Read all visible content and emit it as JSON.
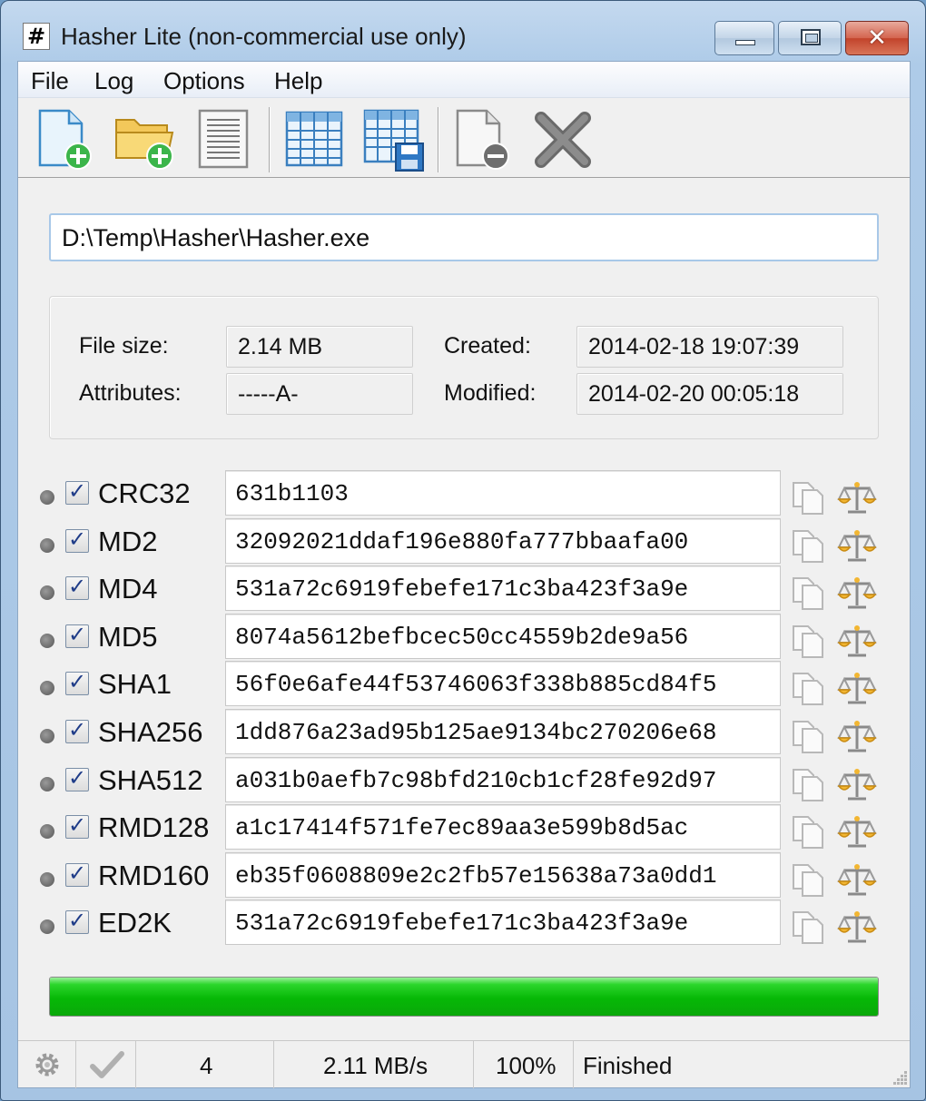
{
  "window": {
    "title": "Hasher Lite (non-commercial use only)",
    "app_icon": "#",
    "close_glyph": "✕"
  },
  "menu": [
    "File",
    "Log",
    "Options",
    "Help"
  ],
  "toolbar": {
    "icons": [
      "add-file-icon",
      "add-folder-icon",
      "text-list-icon",
      "table-icon",
      "save-table-icon",
      "remove-file-icon",
      "clear-icon"
    ]
  },
  "file": {
    "path": "D:\\Temp\\Hasher\\Hasher.exe",
    "size_label": "File size:",
    "size": "2.14 MB",
    "attributes_label": "Attributes:",
    "attributes": "-----A-",
    "created_label": "Created:",
    "created": "2014-02-18 19:07:39",
    "modified_label": "Modified:",
    "modified": "2014-02-20 00:05:18"
  },
  "hashes": [
    {
      "algo": "CRC32",
      "checked": true,
      "value": "631b1103"
    },
    {
      "algo": "MD2",
      "checked": true,
      "value": "32092021ddaf196e880fa777bbaafa00"
    },
    {
      "algo": "MD4",
      "checked": true,
      "value": "531a72c6919febefe171c3ba423f3a9e"
    },
    {
      "algo": "MD5",
      "checked": true,
      "value": "8074a5612befbcec50cc4559b2de9a56"
    },
    {
      "algo": "SHA1",
      "checked": true,
      "value": "56f0e6afe44f53746063f338b885cd84f5"
    },
    {
      "algo": "SHA256",
      "checked": true,
      "value": "1dd876a23ad95b125ae9134bc270206e68"
    },
    {
      "algo": "SHA512",
      "checked": true,
      "value": "a031b0aefb7c98bfd210cb1cf28fe92d97"
    },
    {
      "algo": "RMD128",
      "checked": true,
      "value": "a1c17414f571fe7ec89aa3e599b8d5ac"
    },
    {
      "algo": "RMD160",
      "checked": true,
      "value": "eb35f0608809e2c2fb57e15638a73a0dd1"
    },
    {
      "algo": "ED2K",
      "checked": true,
      "value": "531a72c6919febefe171c3ba423f3a9e"
    }
  ],
  "progress": {
    "fraction": 1.0
  },
  "status": {
    "count": "4",
    "speed": "2.11 MB/s",
    "percent": "100%",
    "state": "Finished"
  },
  "colors": {
    "progress_green": "#06b806",
    "hash_check": "#1f3c88"
  }
}
